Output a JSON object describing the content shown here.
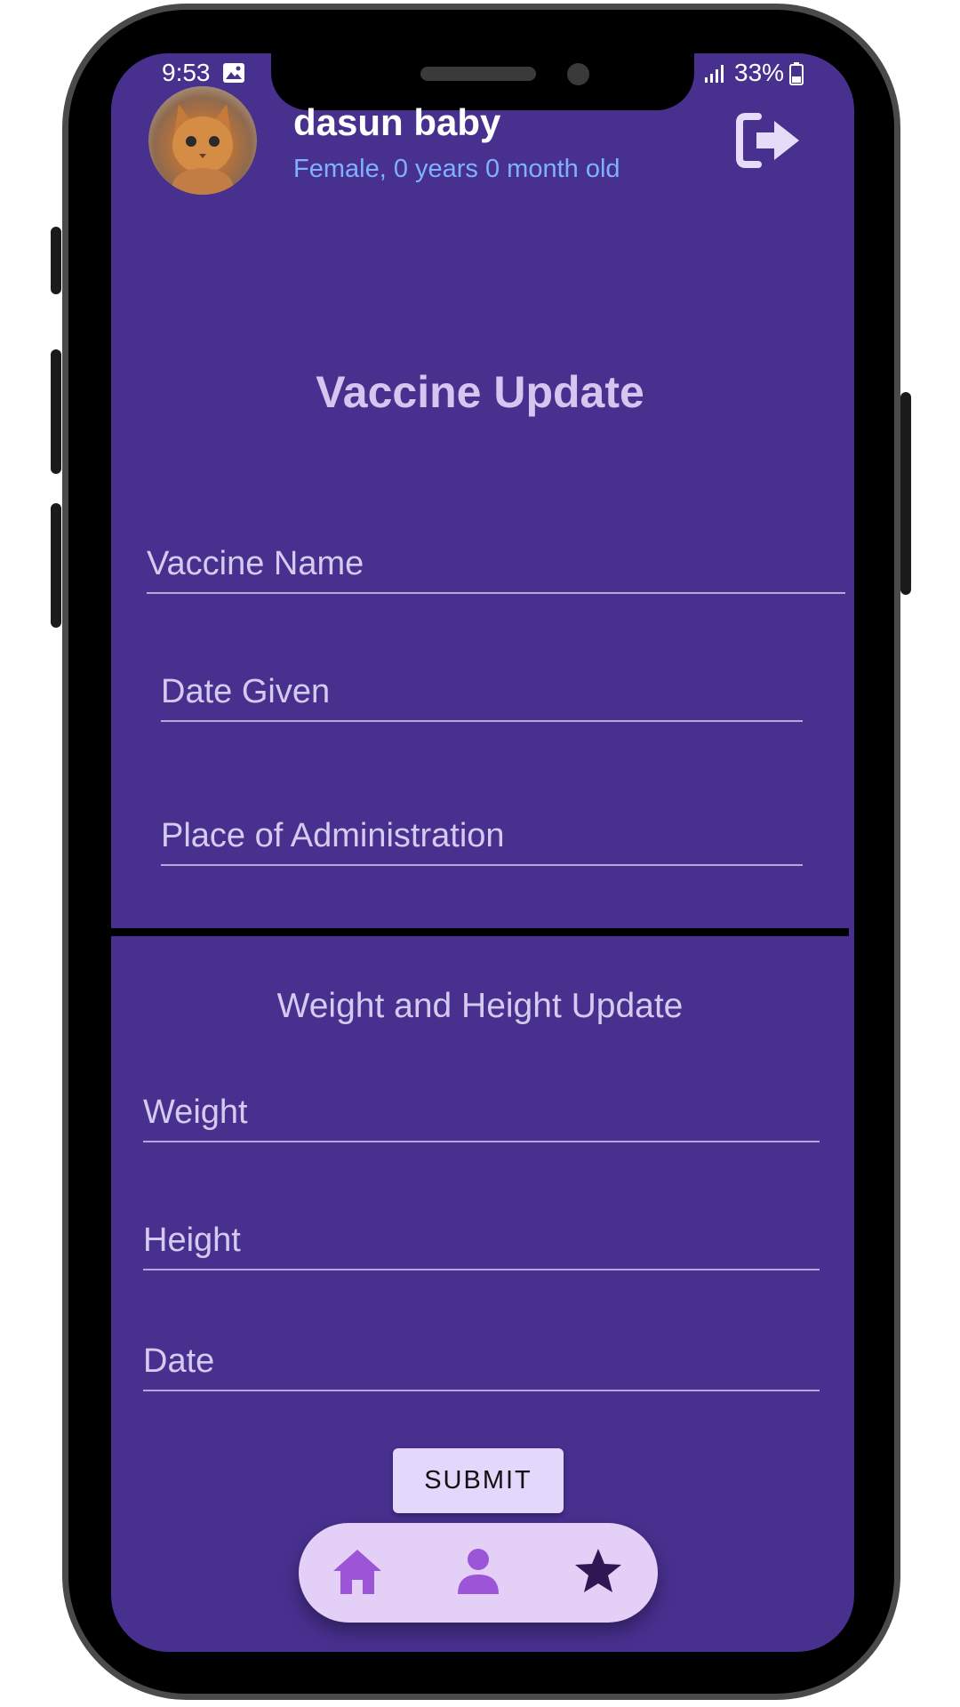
{
  "status_bar": {
    "time": "9:53",
    "battery": "33%"
  },
  "profile": {
    "name": "dasun baby",
    "details": "Female, 0 years 0 month old"
  },
  "vaccine_section": {
    "title": "Vaccine Update",
    "fields": {
      "vaccine_name": "Vaccine Name",
      "date_given": "Date Given",
      "place": "Place of Administration"
    }
  },
  "growth_section": {
    "title": "Weight and Height Update",
    "fields": {
      "weight": "Weight",
      "height": "Height",
      "date": "Date"
    }
  },
  "submit_label": "SUBMIT",
  "nav": {
    "items": [
      "home-icon",
      "person-icon",
      "star-icon"
    ]
  },
  "colors": {
    "screen_bg": "#48308f",
    "nav_bg": "#e4d0f6",
    "nav_accent": "#9c55d6",
    "submit_bg": "#e3d7fb"
  }
}
